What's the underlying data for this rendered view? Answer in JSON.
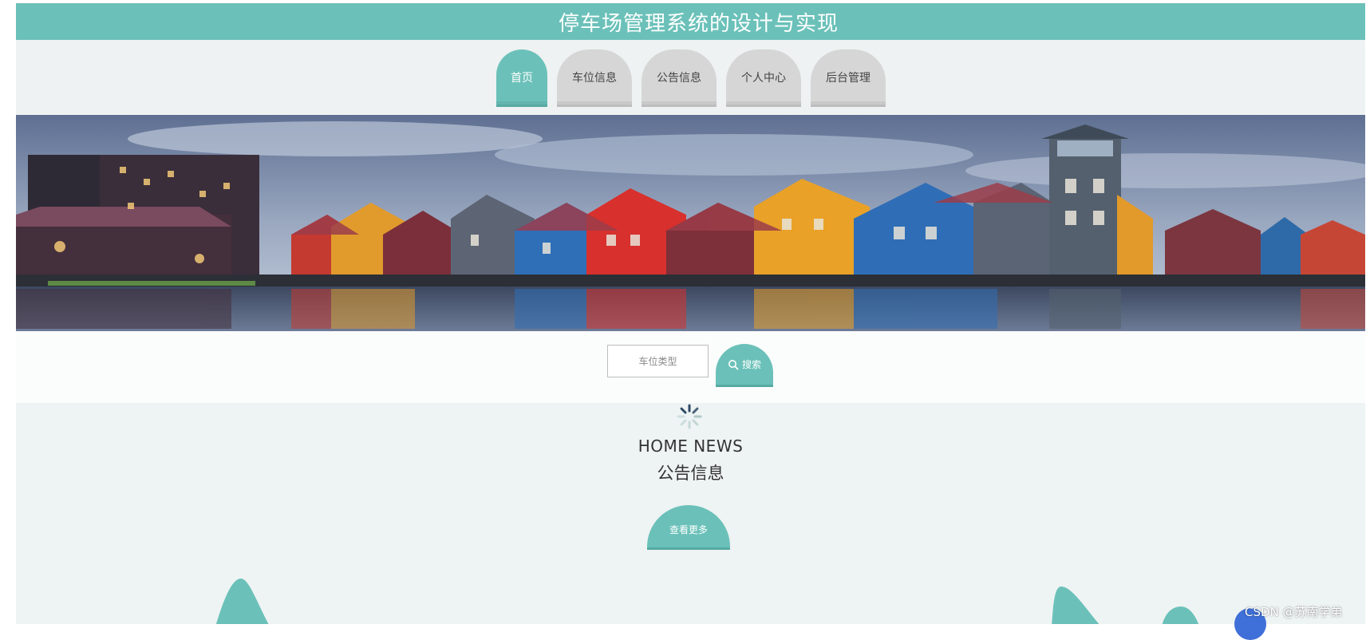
{
  "app": {
    "title": "停车场管理系统的设计与实现"
  },
  "nav": {
    "items": [
      {
        "label": "首页",
        "active": true
      },
      {
        "label": "车位信息",
        "active": false
      },
      {
        "label": "公告信息",
        "active": false
      },
      {
        "label": "个人中心",
        "active": false
      },
      {
        "label": "后台管理",
        "active": false
      }
    ]
  },
  "search": {
    "placeholder": "车位类型",
    "button_label": "搜索"
  },
  "news": {
    "title_en": "HOME NEWS",
    "title_cn": "公告信息",
    "more_label": "查看更多"
  },
  "watermark": "CSDN @苏南学弟",
  "colors": {
    "accent": "#6bc1b9",
    "nav_inactive": "#d6d6d6"
  },
  "icons": {
    "search": "search-icon",
    "loading": "loading-spinner-icon"
  }
}
